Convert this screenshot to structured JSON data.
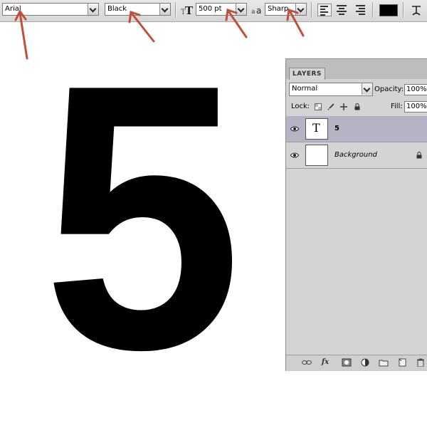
{
  "options_bar": {
    "font_family": "Arial",
    "font_style": "Black",
    "font_size": "500 pt",
    "antialias": "Sharp",
    "text_color": "#000000"
  },
  "canvas": {
    "text": "5"
  },
  "layers_panel": {
    "tab_label": "LAYERS",
    "blend_mode": "Normal",
    "opacity_label": "Opacity:",
    "opacity_value": "100%",
    "lock_label": "Lock:",
    "fill_label": "Fill:",
    "fill_value": "100%",
    "layers": [
      {
        "name": "5",
        "type_glyph": "T",
        "selected": true
      },
      {
        "name": "Background",
        "locked": true
      }
    ],
    "bottom_icons": [
      "link-icon",
      "fx-icon",
      "mask-icon",
      "adjustment-icon",
      "group-icon",
      "new-layer-icon",
      "trash-icon"
    ],
    "fx_label": "fx"
  },
  "annotations": {
    "arrow_color": "#c0503c"
  }
}
